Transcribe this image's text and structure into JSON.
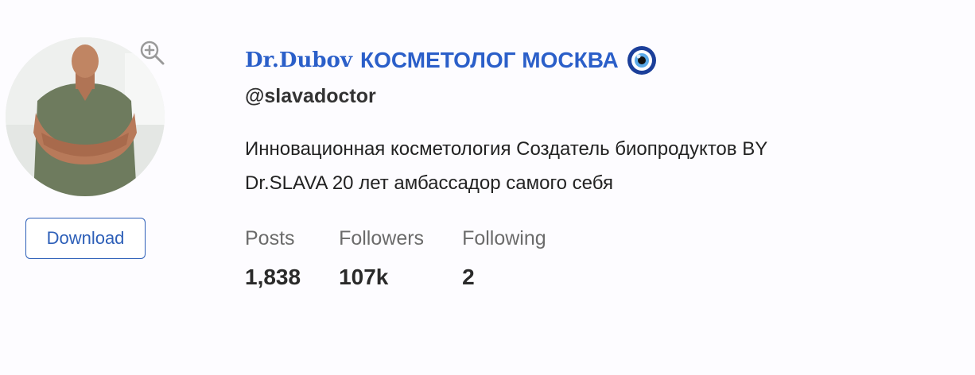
{
  "profile": {
    "name_part1": "Dr.Dubov",
    "name_part2": "КОСМЕТОЛОГ МОСКВА",
    "name_emoji": "nazar-eye-emoji",
    "username": "@slavadoctor",
    "bio_line1": "Инновационная косметология Создатель биопродуктов BY",
    "bio_line2": "Dr.SLAVA 20 лет амбассадор самого себя"
  },
  "avatar": {
    "zoom_icon": "zoom-in-icon"
  },
  "actions": {
    "download_label": "Download"
  },
  "stats": {
    "posts_label": "Posts",
    "posts_value": "1,838",
    "followers_label": "Followers",
    "followers_value": "107k",
    "following_label": "Following",
    "following_value": "2"
  },
  "colors": {
    "accent": "#2b5fc9",
    "button_border": "#2d5fb8",
    "stat_label": "#6b6b6b",
    "text": "#222222"
  }
}
